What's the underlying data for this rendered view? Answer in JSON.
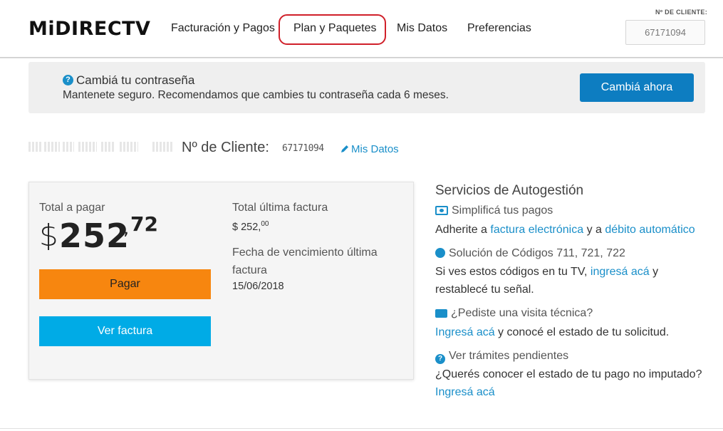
{
  "header": {
    "logo": "MiDIRECTV",
    "nav": [
      "Facturación y Pagos",
      "Plan y Paquetes",
      "Mis Datos",
      "Preferencias"
    ],
    "client_label": "Nº DE CLIENTE:",
    "client_number": "67171094"
  },
  "banner": {
    "title": "Cambiá tu contraseña",
    "text": "Mantenete seguro. Recomendamos que cambies tu contraseña cada 6 meses.",
    "button": "Cambiá ahora"
  },
  "customer": {
    "label": "Nº de Cliente:",
    "number": "67171094",
    "edit_link": "Mis Datos"
  },
  "billing": {
    "total_label": "Total a pagar",
    "currency": "$",
    "amount_int": "252",
    "amount_dec": "72",
    "pay_button": "Pagar",
    "view_button": "Ver factura",
    "last_bill_label": "Total última factura",
    "last_bill_value": "$ 252,",
    "last_bill_cents": "00",
    "due_label": "Fecha de vencimiento última factura",
    "due_value": "15/06/2018"
  },
  "services": {
    "title": "Servicios de Autogestión",
    "items": [
      {
        "heading": "Simplificá tus pagos",
        "text_a": "Adherite a ",
        "link_a": "factura electrónica",
        "text_b": " y a ",
        "link_b": "débito automático"
      },
      {
        "heading": "Solución de Códigos 711, 721, 722",
        "text_a": "Si ves estos códigos en tu TV, ",
        "link_a": "ingresá acá",
        "text_b": " y restablecé tu señal."
      },
      {
        "heading": "¿Pediste una visita técnica?",
        "link_a": "Ingresá acá",
        "text_a": " y conocé el estado de tu solicitud."
      },
      {
        "heading": "Ver trámites pendientes",
        "text_a": "¿Querés conocer el estado de tu pago no imputado?",
        "link_a": "Ingresá acá"
      }
    ]
  },
  "colors": {
    "brand_blue": "#1a8fc9",
    "pay_orange": "#f7860f",
    "bill_cyan": "#00abe6",
    "highlight_red": "#d0202a"
  }
}
